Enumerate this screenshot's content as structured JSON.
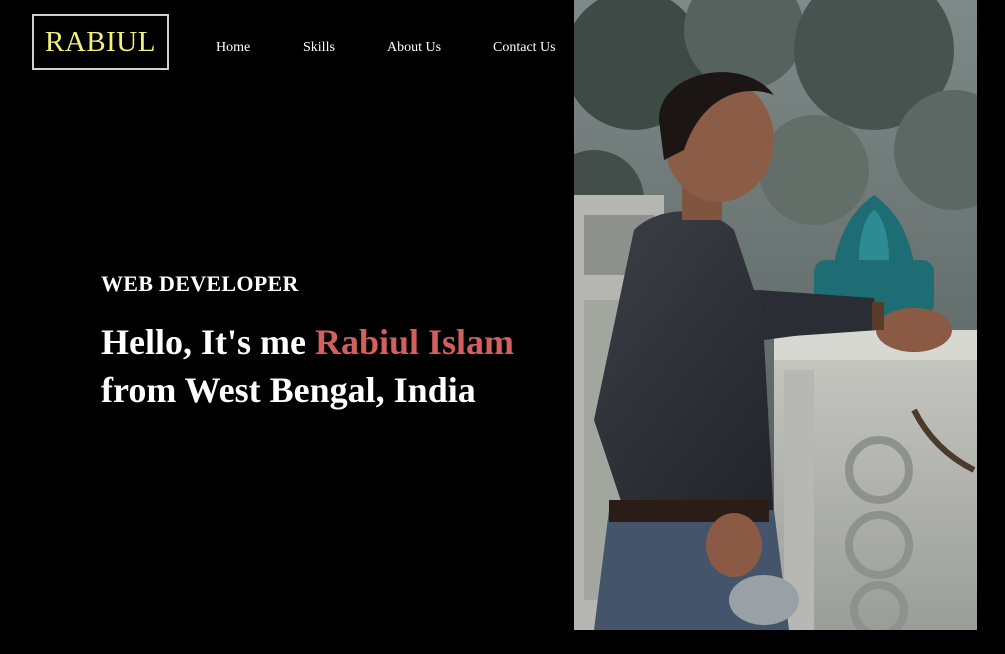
{
  "brand": {
    "logo_text": "RABIUL"
  },
  "nav": {
    "items": [
      {
        "label": "Home"
      },
      {
        "label": "Skills"
      },
      {
        "label": "About Us"
      },
      {
        "label": "Contact Us"
      }
    ]
  },
  "hero": {
    "role": "WEB DEVELOPER",
    "greeting": "Hello, It's me ",
    "name": "Rabiul Islam",
    "location_line": "from West Bengal, India"
  },
  "colors": {
    "background": "#000000",
    "logo_text": "#f2f27a",
    "accent_name": "#d35f5f",
    "text": "#ffffff"
  }
}
